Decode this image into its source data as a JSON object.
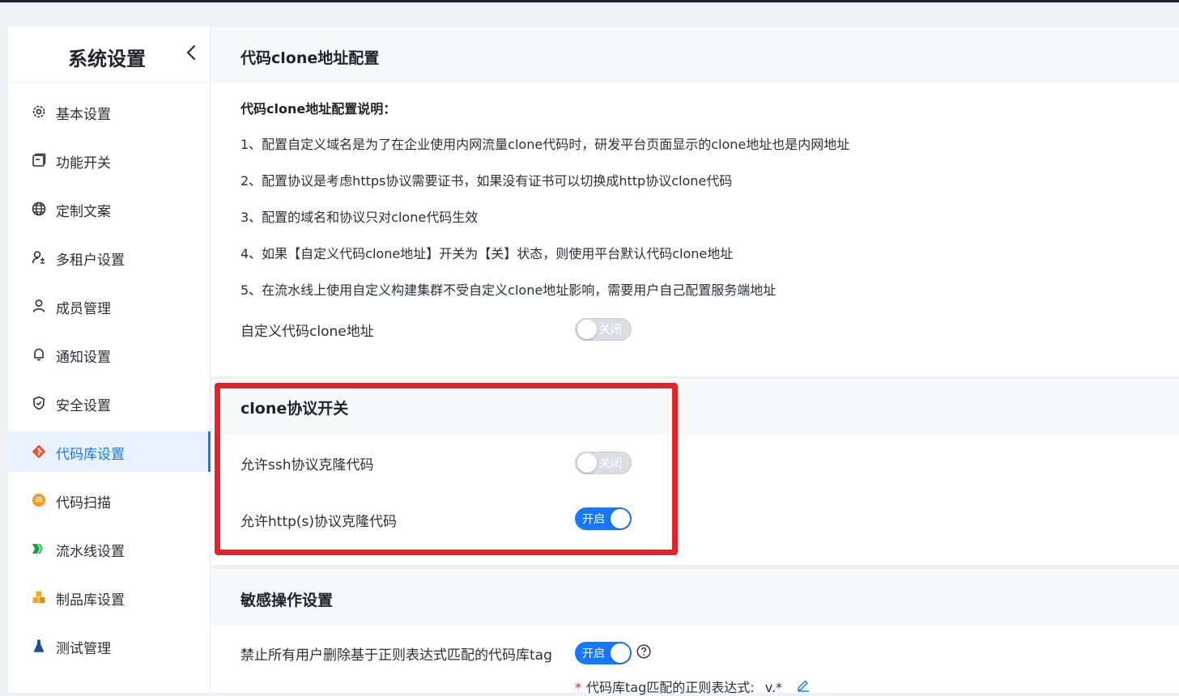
{
  "sidebar": {
    "title": "系统设置",
    "collapse_icon": "chevron-left-icon",
    "items": [
      {
        "label": "基本设置",
        "icon": "gear-icon"
      },
      {
        "label": "功能开关",
        "icon": "window-icon"
      },
      {
        "label": "定制文案",
        "icon": "globe-icon"
      },
      {
        "label": "多租户设置",
        "icon": "tenant-icon"
      },
      {
        "label": "成员管理",
        "icon": "user-icon"
      },
      {
        "label": "通知设置",
        "icon": "bell-icon"
      },
      {
        "label": "安全设置",
        "icon": "shield-icon"
      },
      {
        "label": "代码库设置",
        "icon": "git-icon",
        "active": true
      },
      {
        "label": "代码扫描",
        "icon": "scan-icon"
      },
      {
        "label": "流水线设置",
        "icon": "pipeline-icon"
      },
      {
        "label": "制品库设置",
        "icon": "artifact-icon"
      },
      {
        "label": "测试管理",
        "icon": "flask-icon"
      }
    ]
  },
  "clone_address": {
    "title": "代码clone地址配置",
    "desc_title": "代码clone地址配置说明：",
    "desc_lines": [
      "1、配置自定义域名是为了在企业使用内网流量clone代码时，研发平台页面显示的clone地址也是内网地址",
      "2、配置协议是考虑https协议需要证书，如果没有证书可以切换成http协议clone代码",
      "3、配置的域名和协议只对clone代码生效",
      "4、如果【自定义代码clone地址】开关为【关】状态，则使用平台默认代码clone地址",
      "5、在流水线上使用自定义构建集群不受自定义clone地址影响，需要用户自己配置服务端地址"
    ],
    "custom_label": "自定义代码clone地址",
    "custom_switch": {
      "text": "关闭",
      "on": false
    }
  },
  "clone_protocol": {
    "title": "clone协议开关",
    "ssh_label": "允许ssh协议克隆代码",
    "ssh_switch": {
      "text": "关闭",
      "on": false
    },
    "http_label": "允许http(s)协议克隆代码",
    "http_switch": {
      "text": "开启",
      "on": true
    }
  },
  "sensitive": {
    "title": "敏感操作设置",
    "tag_label": "禁止所有用户删除基于正则表达式匹配的代码库tag",
    "tag_switch": {
      "text": "开启",
      "on": true
    },
    "help_icon": "question-circle-icon",
    "regex_label": "代码库tag匹配的正则表达式:",
    "regex_value": "v.*",
    "edit_icon": "pencil-icon"
  },
  "colors": {
    "accent": "#1677ff",
    "highlight": "#e8202a",
    "switch_off": "#dadde3"
  }
}
